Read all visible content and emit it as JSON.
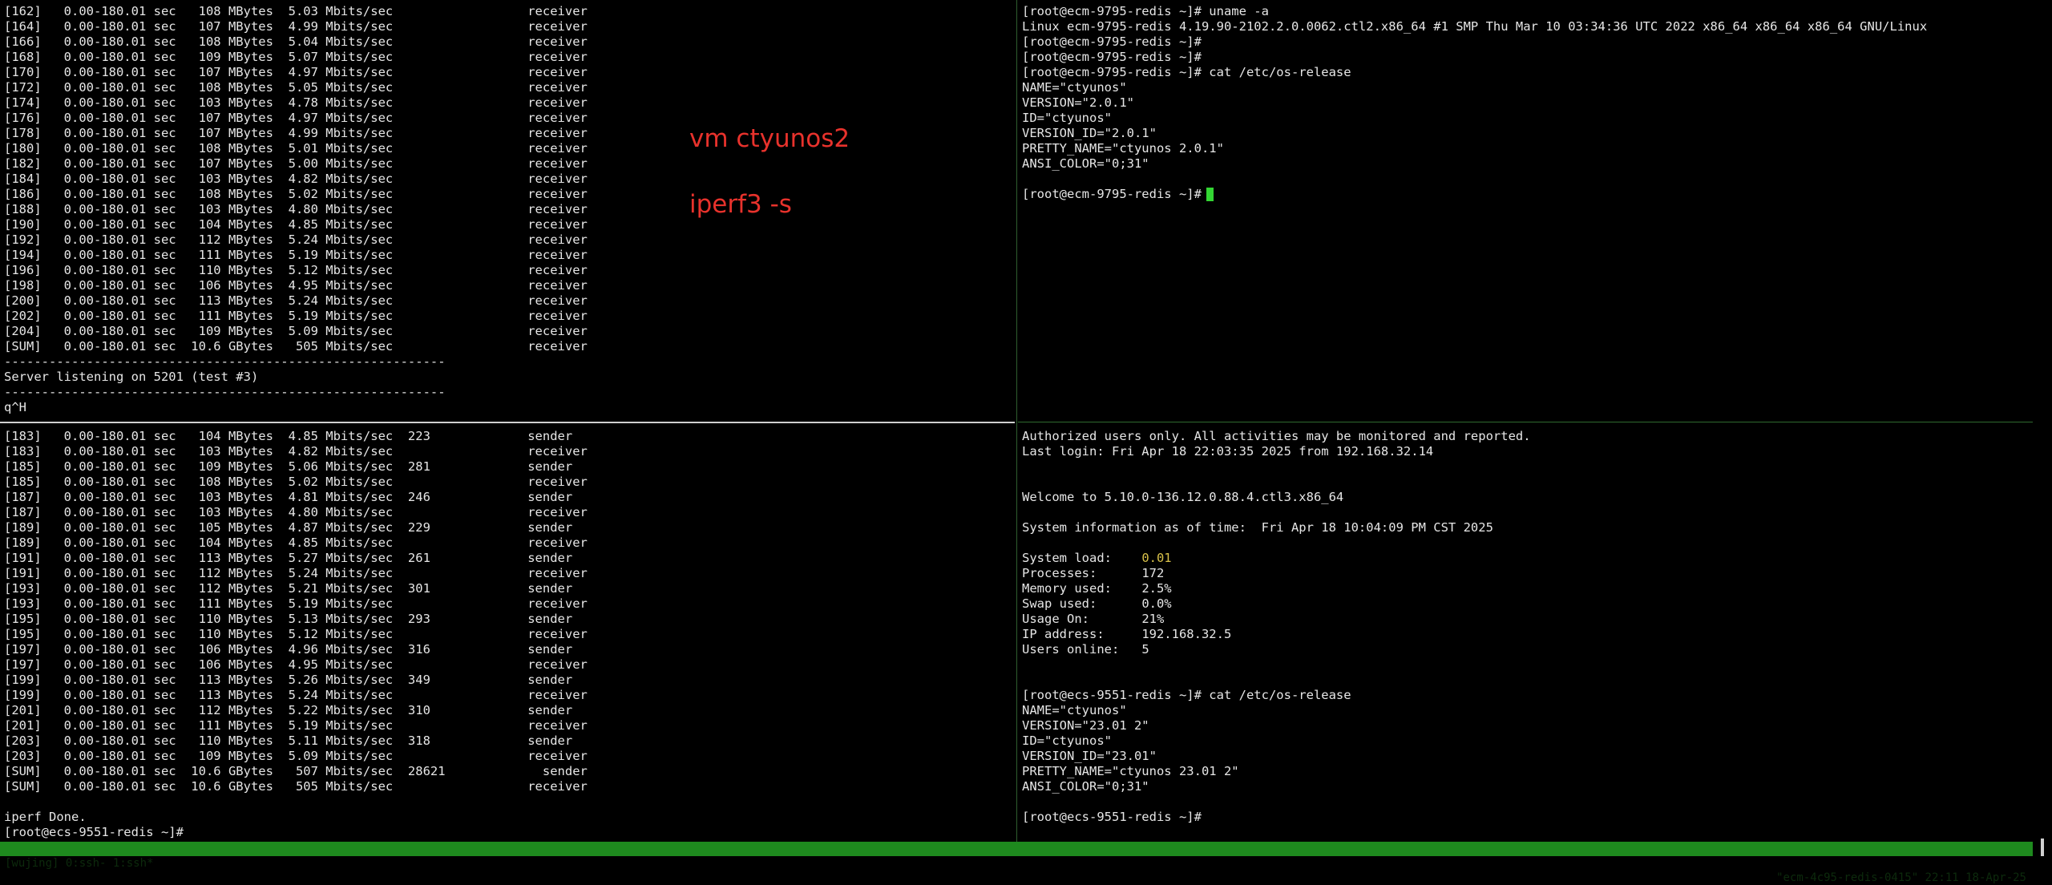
{
  "overlay": {
    "line1": "vm ctyunos2",
    "line2": "iperf3 -s"
  },
  "top_left": {
    "lines": [
      "[162]   0.00-180.01 sec   108 MBytes  5.03 Mbits/sec                  receiver",
      "[164]   0.00-180.01 sec   107 MBytes  4.99 Mbits/sec                  receiver",
      "[166]   0.00-180.01 sec   108 MBytes  5.04 Mbits/sec                  receiver",
      "[168]   0.00-180.01 sec   109 MBytes  5.07 Mbits/sec                  receiver",
      "[170]   0.00-180.01 sec   107 MBytes  4.97 Mbits/sec                  receiver",
      "[172]   0.00-180.01 sec   108 MBytes  5.05 Mbits/sec                  receiver",
      "[174]   0.00-180.01 sec   103 MBytes  4.78 Mbits/sec                  receiver",
      "[176]   0.00-180.01 sec   107 MBytes  4.97 Mbits/sec                  receiver",
      "[178]   0.00-180.01 sec   107 MBytes  4.99 Mbits/sec                  receiver",
      "[180]   0.00-180.01 sec   108 MBytes  5.01 Mbits/sec                  receiver",
      "[182]   0.00-180.01 sec   107 MBytes  5.00 Mbits/sec                  receiver",
      "[184]   0.00-180.01 sec   103 MBytes  4.82 Mbits/sec                  receiver",
      "[186]   0.00-180.01 sec   108 MBytes  5.02 Mbits/sec                  receiver",
      "[188]   0.00-180.01 sec   103 MBytes  4.80 Mbits/sec                  receiver",
      "[190]   0.00-180.01 sec   104 MBytes  4.85 Mbits/sec                  receiver",
      "[192]   0.00-180.01 sec   112 MBytes  5.24 Mbits/sec                  receiver",
      "[194]   0.00-180.01 sec   111 MBytes  5.19 Mbits/sec                  receiver",
      "[196]   0.00-180.01 sec   110 MBytes  5.12 Mbits/sec                  receiver",
      "[198]   0.00-180.01 sec   106 MBytes  4.95 Mbits/sec                  receiver",
      "[200]   0.00-180.01 sec   113 MBytes  5.24 Mbits/sec                  receiver",
      "[202]   0.00-180.01 sec   111 MBytes  5.19 Mbits/sec                  receiver",
      "[204]   0.00-180.01 sec   109 MBytes  5.09 Mbits/sec                  receiver",
      "[SUM]   0.00-180.01 sec  10.6 GBytes   505 Mbits/sec                  receiver",
      "-----------------------------------------------------------",
      "Server listening on 5201 (test #3)",
      "-----------------------------------------------------------",
      "q^H"
    ]
  },
  "top_right": {
    "lines": [
      "[root@ecm-9795-redis ~]# uname -a",
      "Linux ecm-9795-redis 4.19.90-2102.2.0.0062.ctl2.x86_64 #1 SMP Thu Mar 10 03:34:36 UTC 2022 x86_64 x86_64 x86_64 GNU/Linux",
      "[root@ecm-9795-redis ~]#",
      "[root@ecm-9795-redis ~]#",
      "[root@ecm-9795-redis ~]# cat /etc/os-release",
      "NAME=\"ctyunos\"",
      "VERSION=\"2.0.1\"",
      "ID=\"ctyunos\"",
      "VERSION_ID=\"2.0.1\"",
      "PRETTY_NAME=\"ctyunos 2.0.1\"",
      "ANSI_COLOR=\"0;31\"",
      ""
    ],
    "prompt": "[root@ecm-9795-redis ~]#"
  },
  "bottom_left": {
    "lines": [
      "[183]   0.00-180.01 sec   104 MBytes  4.85 Mbits/sec  223             sender",
      "[183]   0.00-180.01 sec   103 MBytes  4.82 Mbits/sec                  receiver",
      "[185]   0.00-180.01 sec   109 MBytes  5.06 Mbits/sec  281             sender",
      "[185]   0.00-180.01 sec   108 MBytes  5.02 Mbits/sec                  receiver",
      "[187]   0.00-180.01 sec   103 MBytes  4.81 Mbits/sec  246             sender",
      "[187]   0.00-180.01 sec   103 MBytes  4.80 Mbits/sec                  receiver",
      "[189]   0.00-180.01 sec   105 MBytes  4.87 Mbits/sec  229             sender",
      "[189]   0.00-180.01 sec   104 MBytes  4.85 Mbits/sec                  receiver",
      "[191]   0.00-180.01 sec   113 MBytes  5.27 Mbits/sec  261             sender",
      "[191]   0.00-180.01 sec   112 MBytes  5.24 Mbits/sec                  receiver",
      "[193]   0.00-180.01 sec   112 MBytes  5.21 Mbits/sec  301             sender",
      "[193]   0.00-180.01 sec   111 MBytes  5.19 Mbits/sec                  receiver",
      "[195]   0.00-180.01 sec   110 MBytes  5.13 Mbits/sec  293             sender",
      "[195]   0.00-180.01 sec   110 MBytes  5.12 Mbits/sec                  receiver",
      "[197]   0.00-180.01 sec   106 MBytes  4.96 Mbits/sec  316             sender",
      "[197]   0.00-180.01 sec   106 MBytes  4.95 Mbits/sec                  receiver",
      "[199]   0.00-180.01 sec   113 MBytes  5.26 Mbits/sec  349             sender",
      "[199]   0.00-180.01 sec   113 MBytes  5.24 Mbits/sec                  receiver",
      "[201]   0.00-180.01 sec   112 MBytes  5.22 Mbits/sec  310             sender",
      "[201]   0.00-180.01 sec   111 MBytes  5.19 Mbits/sec                  receiver",
      "[203]   0.00-180.01 sec   110 MBytes  5.11 Mbits/sec  318             sender",
      "[203]   0.00-180.01 sec   109 MBytes  5.09 Mbits/sec                  receiver",
      "[SUM]   0.00-180.01 sec  10.6 GBytes   507 Mbits/sec  28621             sender",
      "[SUM]   0.00-180.01 sec  10.6 GBytes   505 Mbits/sec                  receiver",
      "",
      "iperf Done.",
      "[root@ecs-9551-redis ~]#"
    ]
  },
  "bottom_right": {
    "lines_top": [
      "Authorized users only. All activities may be monitored and reported.",
      "Last login: Fri Apr 18 22:03:35 2025 from 192.168.32.14",
      "",
      "",
      "Welcome to 5.10.0-136.12.0.88.4.ctl3.x86_64",
      "",
      "System information as of time:  Fri Apr 18 10:04:09 PM CST 2025",
      ""
    ],
    "sysinfo": [
      {
        "label": "System load:    ",
        "value": "0.01"
      },
      {
        "label": "Processes:      ",
        "value": "172"
      },
      {
        "label": "Memory used:    ",
        "value": "2.5%"
      },
      {
        "label": "Swap used:      ",
        "value": "0.0%"
      },
      {
        "label": "Usage On:       ",
        "value": "21%"
      },
      {
        "label": "IP address:     ",
        "value": "192.168.32.5"
      },
      {
        "label": "Users online:   ",
        "value": "5"
      }
    ],
    "lines_bottom": [
      "",
      "",
      "[root@ecs-9551-redis ~]# cat /etc/os-release",
      "NAME=\"ctyunos\"",
      "VERSION=\"23.01 2\"",
      "ID=\"ctyunos\"",
      "VERSION_ID=\"23.01\"",
      "PRETTY_NAME=\"ctyunos 23.01 2\"",
      "ANSI_COLOR=\"0;31\"",
      "",
      "[root@ecs-9551-redis ~]#"
    ]
  },
  "status": {
    "left": "[wujing] 0:ssh- 1:ssh*",
    "right": "\"ecm-4c95-redis-0415\" 22:11 18-Apr-25"
  },
  "colors": {
    "background": "#000000",
    "text": "#e6e6e6",
    "overlay_text": "#e8322c",
    "status_bar": "#1e8a1e",
    "cursor": "#33d633",
    "highlight": "#d8c14a"
  }
}
